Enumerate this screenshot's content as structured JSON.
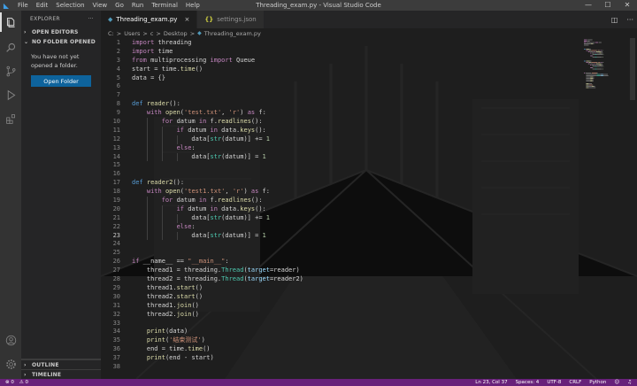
{
  "titlebar": {
    "menu": [
      "File",
      "Edit",
      "Selection",
      "View",
      "Go",
      "Run",
      "Terminal",
      "Help"
    ],
    "window_title": "Threading_exam.py - Visual Studio Code",
    "controls": [
      "—",
      "☐",
      "✕"
    ]
  },
  "activity": [
    "explorer-icon",
    "search-icon",
    "source-control-icon",
    "run-debug-icon",
    "extensions-icon",
    "account-icon",
    "gear-icon"
  ],
  "sidebar": {
    "title": "EXPLORER",
    "more": "···",
    "open_editors": "OPEN EDITORS",
    "no_folder": "NO FOLDER OPENED",
    "message": "You have not yet opened a folder.",
    "button": "Open Folder",
    "outline": "OUTLINE",
    "timeline": "TIMELINE"
  },
  "tabs": [
    {
      "icon": "◆",
      "label": "Threading_exam.py",
      "close": "×",
      "active": true,
      "icon_color": "#519aba"
    },
    {
      "icon": "{}",
      "label": "settings.json",
      "close": "",
      "active": false,
      "icon_color": "#cbcb41"
    }
  ],
  "breadcrumb": [
    "C:",
    "Users",
    "c",
    "Desktop",
    "Threading_exam.py"
  ],
  "breadcrumb_sep": ">",
  "code": [
    [
      [
        "import",
        "kc"
      ],
      [
        " threading",
        ""
      ]
    ],
    [
      [
        "import",
        "kc"
      ],
      [
        " time",
        ""
      ]
    ],
    [
      [
        "from",
        "kc"
      ],
      [
        " multiprocessing ",
        ""
      ],
      [
        "import",
        "kc"
      ],
      [
        " Queue",
        ""
      ]
    ],
    [
      [
        "start = time.",
        ""
      ],
      [
        "time",
        "fn"
      ],
      [
        "()",
        ""
      ]
    ],
    [
      [
        "data = {}",
        ""
      ]
    ],
    [],
    [],
    [
      [
        "def",
        "k"
      ],
      [
        " ",
        ""
      ],
      [
        "reader",
        "fn"
      ],
      [
        "():",
        ""
      ]
    ],
    [
      [
        "    ",
        ""
      ],
      [
        "with",
        "kc"
      ],
      [
        " ",
        ""
      ],
      [
        "open",
        "fn"
      ],
      [
        "(",
        ""
      ],
      [
        "'test.txt'",
        "s"
      ],
      [
        ", ",
        ""
      ],
      [
        "'r'",
        "s"
      ],
      [
        ") ",
        ""
      ],
      [
        "as",
        "kc"
      ],
      [
        " f:",
        ""
      ]
    ],
    [
      [
        "        ",
        ""
      ],
      [
        "for",
        "kc"
      ],
      [
        " datum ",
        ""
      ],
      [
        "in",
        "kc"
      ],
      [
        " f.",
        ""
      ],
      [
        "readlines",
        "fn"
      ],
      [
        "():",
        ""
      ]
    ],
    [
      [
        "            ",
        ""
      ],
      [
        "if",
        "kc"
      ],
      [
        " datum ",
        ""
      ],
      [
        "in",
        "kc"
      ],
      [
        " data.",
        ""
      ],
      [
        "keys",
        "fn"
      ],
      [
        "():",
        ""
      ]
    ],
    [
      [
        "                data[",
        ""
      ],
      [
        "str",
        "b"
      ],
      [
        "(datum)] += ",
        ""
      ],
      [
        "1",
        "n"
      ]
    ],
    [
      [
        "            ",
        ""
      ],
      [
        "else",
        "kc"
      ],
      [
        ":",
        ""
      ]
    ],
    [
      [
        "                data[",
        ""
      ],
      [
        "str",
        "b"
      ],
      [
        "(datum)] = ",
        ""
      ],
      [
        "1",
        "n"
      ]
    ],
    [],
    [],
    [
      [
        "def",
        "k"
      ],
      [
        " ",
        ""
      ],
      [
        "reader2",
        "fn"
      ],
      [
        "():",
        ""
      ]
    ],
    [
      [
        "    ",
        ""
      ],
      [
        "with",
        "kc"
      ],
      [
        " ",
        ""
      ],
      [
        "open",
        "fn"
      ],
      [
        "(",
        ""
      ],
      [
        "'test1.txt'",
        "s"
      ],
      [
        ", ",
        ""
      ],
      [
        "'r'",
        "s"
      ],
      [
        ") ",
        ""
      ],
      [
        "as",
        "kc"
      ],
      [
        " f:",
        ""
      ]
    ],
    [
      [
        "        ",
        ""
      ],
      [
        "for",
        "kc"
      ],
      [
        " datum ",
        ""
      ],
      [
        "in",
        "kc"
      ],
      [
        " f.",
        ""
      ],
      [
        "readlines",
        "fn"
      ],
      [
        "():",
        ""
      ]
    ],
    [
      [
        "            ",
        ""
      ],
      [
        "if",
        "kc"
      ],
      [
        " datum ",
        ""
      ],
      [
        "in",
        "kc"
      ],
      [
        " data.",
        ""
      ],
      [
        "keys",
        "fn"
      ],
      [
        "():",
        ""
      ]
    ],
    [
      [
        "                data[",
        ""
      ],
      [
        "str",
        "b"
      ],
      [
        "(datum)] += ",
        ""
      ],
      [
        "1",
        "n"
      ]
    ],
    [
      [
        "            ",
        ""
      ],
      [
        "else",
        "kc"
      ],
      [
        ":",
        ""
      ]
    ],
    [
      [
        "                data[",
        ""
      ],
      [
        "str",
        "b"
      ],
      [
        "(datum)] = ",
        ""
      ],
      [
        "1",
        "n"
      ]
    ],
    [],
    [],
    [
      [
        "if",
        "kc"
      ],
      [
        " __name__ == ",
        ""
      ],
      [
        "\"__main__\"",
        "s"
      ],
      [
        ":",
        ""
      ]
    ],
    [
      [
        "    thread1 = threading.",
        ""
      ],
      [
        "Thread",
        "b"
      ],
      [
        "(",
        ""
      ],
      [
        "target",
        "v"
      ],
      [
        "=reader)",
        ""
      ]
    ],
    [
      [
        "    thread2 = threading.",
        ""
      ],
      [
        "Thread",
        "b"
      ],
      [
        "(",
        ""
      ],
      [
        "target",
        "v"
      ],
      [
        "=reader2)",
        ""
      ]
    ],
    [
      [
        "    thread1.",
        ""
      ],
      [
        "start",
        "fn"
      ],
      [
        "()",
        ""
      ]
    ],
    [
      [
        "    thread2.",
        ""
      ],
      [
        "start",
        "fn"
      ],
      [
        "()",
        ""
      ]
    ],
    [
      [
        "    thread1.",
        ""
      ],
      [
        "join",
        "fn"
      ],
      [
        "()",
        ""
      ]
    ],
    [
      [
        "    thread2.",
        ""
      ],
      [
        "join",
        "fn"
      ],
      [
        "()",
        ""
      ]
    ],
    [],
    [
      [
        "    ",
        ""
      ],
      [
        "print",
        "fn"
      ],
      [
        "(data)",
        ""
      ]
    ],
    [
      [
        "    ",
        ""
      ],
      [
        "print",
        "fn"
      ],
      [
        "(",
        ""
      ],
      [
        "'结束测试'",
        "s"
      ],
      [
        ")",
        ""
      ]
    ],
    [
      [
        "    end = time.",
        ""
      ],
      [
        "time",
        "fn"
      ],
      [
        "()",
        ""
      ]
    ],
    [
      [
        "    ",
        ""
      ],
      [
        "print",
        "fn"
      ],
      [
        "(end - start)",
        ""
      ]
    ],
    []
  ],
  "current_line": 23,
  "status": {
    "errors": "⊗ 0",
    "warnings": "⚠ 0",
    "position": "Ln 23, Col 37",
    "spaces": "Spaces: 4",
    "encoding": "UTF-8",
    "eol": "CRLF",
    "language": "Python",
    "feedback_icon": "feedback-icon",
    "bell_icon": "bell-icon"
  }
}
